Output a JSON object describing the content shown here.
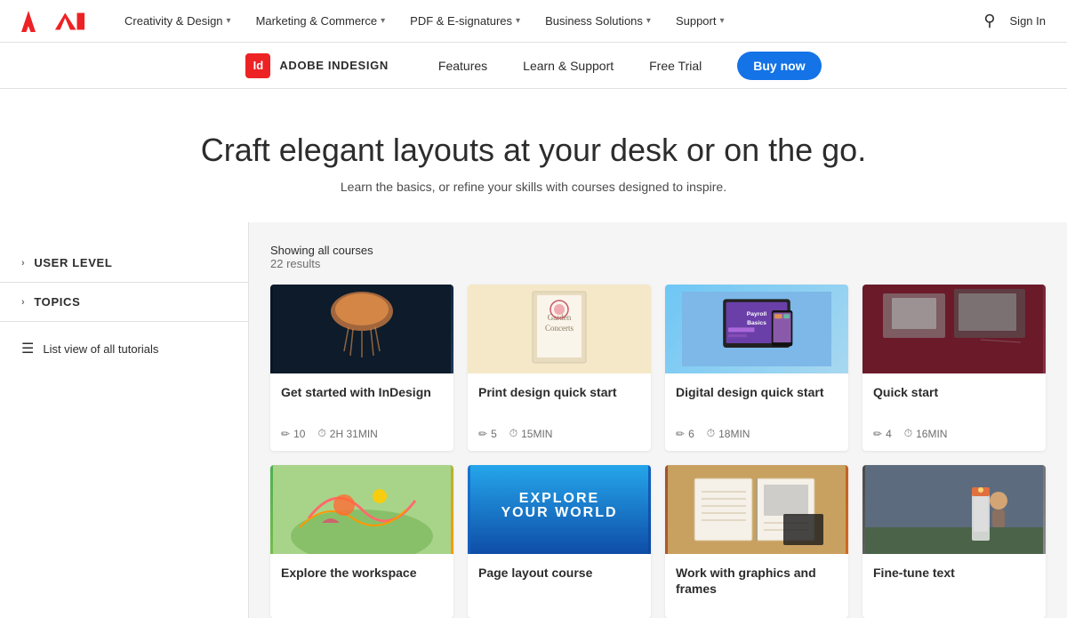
{
  "header": {
    "logo_alt": "Adobe",
    "nav": [
      {
        "label": "Creativity & Design",
        "has_dropdown": true
      },
      {
        "label": "Marketing & Commerce",
        "has_dropdown": true
      },
      {
        "label": "PDF & E-signatures",
        "has_dropdown": true
      },
      {
        "label": "Business Solutions",
        "has_dropdown": true
      },
      {
        "label": "Support",
        "has_dropdown": true
      }
    ],
    "sign_in": "Sign In"
  },
  "product_subnav": {
    "icon_text": "Id",
    "product_name": "ADOBE INDESIGN",
    "links": [
      "Features",
      "Learn & Support",
      "Free Trial"
    ],
    "cta": "Buy now"
  },
  "hero": {
    "title": "Craft elegant layouts at your desk or on the go.",
    "subtitle": "Learn the basics, or refine your skills with courses designed to inspire."
  },
  "sidebar": {
    "filters": [
      {
        "label": "USER LEVEL"
      },
      {
        "label": "TOPICS"
      }
    ],
    "list_view_label": "List view of all tutorials"
  },
  "results": {
    "showing_label": "Showing all courses",
    "count_label": "22 results"
  },
  "courses": [
    {
      "title": "Get started with InDesign",
      "lessons": "10",
      "duration": "2H 31MIN",
      "thumb_type": "jellyfish"
    },
    {
      "title": "Print design quick start",
      "lessons": "5",
      "duration": "15MIN",
      "thumb_type": "cream"
    },
    {
      "title": "Digital design quick start",
      "lessons": "6",
      "duration": "18MIN",
      "thumb_type": "tablet"
    },
    {
      "title": "Quick start",
      "lessons": "4",
      "duration": "16MIN",
      "thumb_type": "maroon"
    },
    {
      "title": "Explore the workspace",
      "lessons": "",
      "duration": "",
      "thumb_type": "colorful"
    },
    {
      "title": "Page layout course",
      "lessons": "",
      "duration": "",
      "thumb_type": "ocean"
    },
    {
      "title": "Work with graphics and frames",
      "lessons": "",
      "duration": "",
      "thumb_type": "book"
    },
    {
      "title": "Fine-tune text",
      "lessons": "",
      "duration": "",
      "thumb_type": "lighthouse"
    }
  ]
}
